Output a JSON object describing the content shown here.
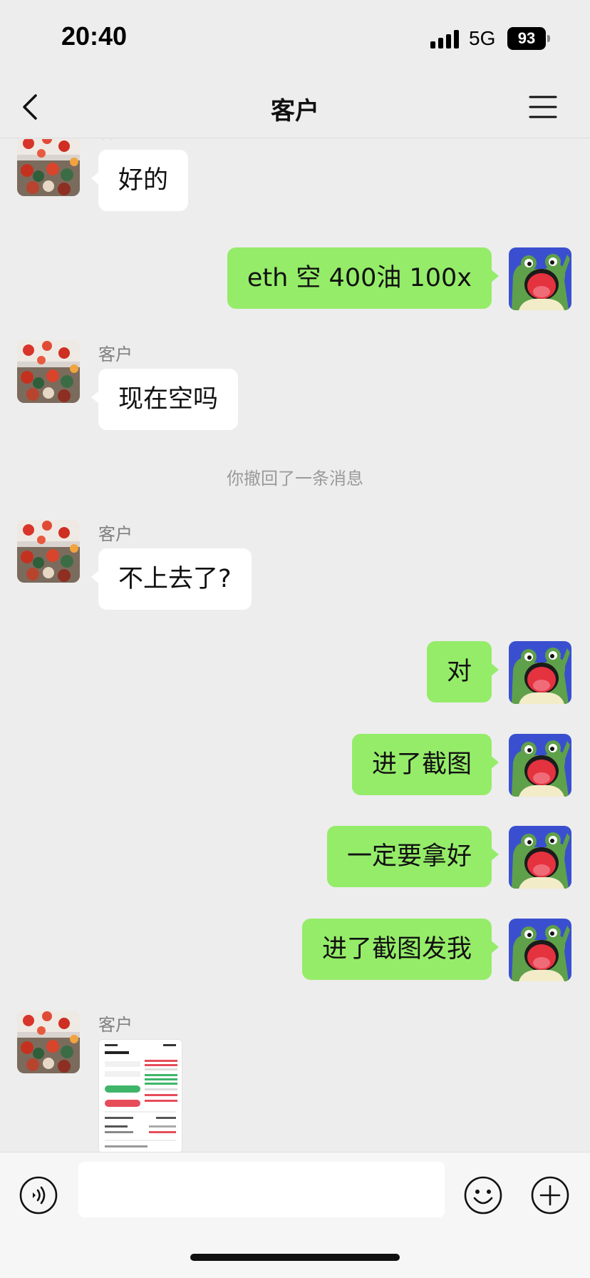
{
  "status_bar": {
    "time": "20:40",
    "network": "5G",
    "battery": "93"
  },
  "header": {
    "title": "客户"
  },
  "icons": {
    "back": "back-chevron-icon",
    "menu": "menu-icon",
    "voice": "voice-icon",
    "emoji": "emoji-icon",
    "plus": "plus-icon"
  },
  "colors": {
    "outgoing_bubble": "#95ec69",
    "incoming_bubble": "#ffffff",
    "background": "#ededed"
  },
  "messages": [
    {
      "direction": "in",
      "sender": "客户",
      "text": "好的"
    },
    {
      "direction": "out",
      "text": "eth 空 400油 100x"
    },
    {
      "direction": "in",
      "sender": "客户",
      "text": "现在空吗"
    },
    {
      "type": "system",
      "text": "你撤回了一条消息"
    },
    {
      "direction": "in",
      "sender": "客户",
      "text": "不上去了?"
    },
    {
      "direction": "out",
      "text": "对"
    },
    {
      "direction": "out",
      "text": "进了截图"
    },
    {
      "direction": "out",
      "text": "一定要拿好"
    },
    {
      "direction": "out",
      "text": "进了截图发我"
    },
    {
      "direction": "in",
      "sender": "客户",
      "type": "image",
      "text": ""
    }
  ],
  "input": {
    "value": ""
  }
}
